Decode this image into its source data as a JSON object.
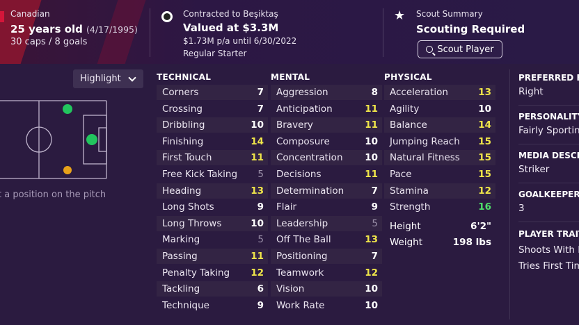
{
  "header": {
    "nationality": "Canadian",
    "age_text": "25 years old",
    "dob": "(4/17/1995)",
    "caps_goals": "30 caps / 8 goals",
    "contract_label": "Contracted to Beşiktaş",
    "value": "Valued at $3.3M",
    "wage": "$1.73M p/a until 6/30/2022",
    "squad_status": "Regular Starter",
    "scout_label": "Scout Summary",
    "scout_status": "Scouting Required",
    "scout_button": "Scout Player"
  },
  "pitch": {
    "highlight_label": "Highlight",
    "hint": "t a position on the pitch",
    "positions": [
      {
        "role": "natural",
        "color": "#22c55e"
      },
      {
        "role": "accomplished",
        "color": "#22c55e"
      },
      {
        "role": "unconvincing",
        "color": "#e8a21a"
      }
    ]
  },
  "attributes": {
    "technical": {
      "title": "TECHNICAL",
      "items": [
        {
          "name": "Corners",
          "value": "7",
          "tone": "white"
        },
        {
          "name": "Crossing",
          "value": "7",
          "tone": "white"
        },
        {
          "name": "Dribbling",
          "value": "10",
          "tone": "white"
        },
        {
          "name": "Finishing",
          "value": "14",
          "tone": "yellow"
        },
        {
          "name": "First Touch",
          "value": "11",
          "tone": "yellow"
        },
        {
          "name": "Free Kick Taking",
          "value": "5",
          "tone": "grey"
        },
        {
          "name": "Heading",
          "value": "13",
          "tone": "yellow"
        },
        {
          "name": "Long Shots",
          "value": "9",
          "tone": "white"
        },
        {
          "name": "Long Throws",
          "value": "10",
          "tone": "white"
        },
        {
          "name": "Marking",
          "value": "5",
          "tone": "grey"
        },
        {
          "name": "Passing",
          "value": "11",
          "tone": "yellow"
        },
        {
          "name": "Penalty Taking",
          "value": "12",
          "tone": "yellow"
        },
        {
          "name": "Tackling",
          "value": "6",
          "tone": "white"
        },
        {
          "name": "Technique",
          "value": "9",
          "tone": "white"
        }
      ]
    },
    "mental": {
      "title": "MENTAL",
      "items": [
        {
          "name": "Aggression",
          "value": "8",
          "tone": "white"
        },
        {
          "name": "Anticipation",
          "value": "11",
          "tone": "yellow"
        },
        {
          "name": "Bravery",
          "value": "11",
          "tone": "yellow"
        },
        {
          "name": "Composure",
          "value": "10",
          "tone": "white"
        },
        {
          "name": "Concentration",
          "value": "10",
          "tone": "white"
        },
        {
          "name": "Decisions",
          "value": "11",
          "tone": "yellow"
        },
        {
          "name": "Determination",
          "value": "7",
          "tone": "white"
        },
        {
          "name": "Flair",
          "value": "9",
          "tone": "white"
        },
        {
          "name": "Leadership",
          "value": "5",
          "tone": "grey"
        },
        {
          "name": "Off The Ball",
          "value": "13",
          "tone": "yellow"
        },
        {
          "name": "Positioning",
          "value": "7",
          "tone": "white"
        },
        {
          "name": "Teamwork",
          "value": "12",
          "tone": "yellow"
        },
        {
          "name": "Vision",
          "value": "10",
          "tone": "white"
        },
        {
          "name": "Work Rate",
          "value": "10",
          "tone": "white"
        }
      ]
    },
    "physical": {
      "title": "PHYSICAL",
      "items": [
        {
          "name": "Acceleration",
          "value": "13",
          "tone": "yellow"
        },
        {
          "name": "Agility",
          "value": "10",
          "tone": "white"
        },
        {
          "name": "Balance",
          "value": "14",
          "tone": "yellow"
        },
        {
          "name": "Jumping Reach",
          "value": "15",
          "tone": "yellow"
        },
        {
          "name": "Natural Fitness",
          "value": "15",
          "tone": "yellow"
        },
        {
          "name": "Pace",
          "value": "15",
          "tone": "yellow"
        },
        {
          "name": "Stamina",
          "value": "12",
          "tone": "yellow"
        },
        {
          "name": "Strength",
          "value": "16",
          "tone": "green"
        }
      ],
      "height_label": "Height",
      "height_value": "6'2\"",
      "weight_label": "Weight",
      "weight_value": "198 lbs"
    }
  },
  "right_panel": {
    "preferred_foot_title": "PREFERRED FO",
    "preferred_foot_value": "Right",
    "personality_title": "PERSONALITY",
    "personality_value": "Fairly Sporting",
    "media_title": "MEDIA DESCR",
    "media_value": "Striker",
    "gk_title": "GOALKEEPER R",
    "gk_value": "3",
    "traits_title": "PLAYER TRAIT",
    "traits": [
      "Shoots With Po",
      "Tries First Time"
    ]
  },
  "colors": {
    "yellow": "#f0e64a",
    "green": "#4fe06a",
    "grey": "#9a8fa8"
  }
}
